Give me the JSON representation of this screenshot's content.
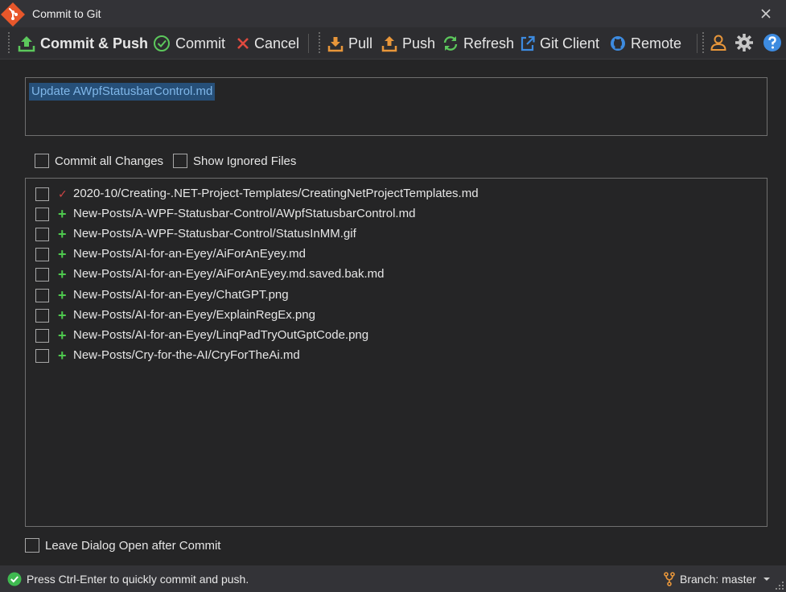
{
  "window": {
    "title": "Commit to Git"
  },
  "toolbar": {
    "commit_push": "Commit & Push",
    "commit": "Commit",
    "cancel": "Cancel",
    "pull": "Pull",
    "push": "Push",
    "refresh": "Refresh",
    "git_client": "Git Client",
    "remote": "Remote"
  },
  "commit_message": {
    "value": "Update AWpfStatusbarControl.md"
  },
  "options": {
    "commit_all_label": "Commit all Changes",
    "show_ignored_label": "Show Ignored Files",
    "commit_all_checked": false,
    "show_ignored_checked": false
  },
  "files": [
    {
      "status": "modified",
      "status_glyph": "✓",
      "path": "2020-10/Creating-.NET-Project-Templates/CreatingNetProjectTemplates.md",
      "checked": false
    },
    {
      "status": "added",
      "status_glyph": "+",
      "path": "New-Posts/A-WPF-Statusbar-Control/AWpfStatusbarControl.md",
      "checked": false
    },
    {
      "status": "added",
      "status_glyph": "+",
      "path": "New-Posts/A-WPF-Statusbar-Control/StatusInMM.gif",
      "checked": false
    },
    {
      "status": "added",
      "status_glyph": "+",
      "path": "New-Posts/AI-for-an-Eyey/AiForAnEyey.md",
      "checked": false
    },
    {
      "status": "added",
      "status_glyph": "+",
      "path": "New-Posts/AI-for-an-Eyey/AiForAnEyey.md.saved.bak.md",
      "checked": false
    },
    {
      "status": "added",
      "status_glyph": "+",
      "path": "New-Posts/AI-for-an-Eyey/ChatGPT.png",
      "checked": false
    },
    {
      "status": "added",
      "status_glyph": "+",
      "path": "New-Posts/AI-for-an-Eyey/ExplainRegEx.png",
      "checked": false
    },
    {
      "status": "added",
      "status_glyph": "+",
      "path": "New-Posts/AI-for-an-Eyey/LinqPadTryOutGptCode.png",
      "checked": false
    },
    {
      "status": "added",
      "status_glyph": "+",
      "path": "New-Posts/Cry-for-the-AI/CryForTheAi.md",
      "checked": false
    }
  ],
  "leave_open": {
    "label": "Leave Dialog Open after Commit",
    "checked": false
  },
  "statusbar": {
    "message": "Press Ctrl-Enter to quickly commit and push.",
    "branch": "Branch: master"
  },
  "colors": {
    "added": "#4ec94e",
    "modified": "#d04545",
    "accent_orange": "#e8963a",
    "accent_green": "#5cc85c",
    "accent_blue": "#3d8be0",
    "cancel_red": "#e04a3f"
  }
}
